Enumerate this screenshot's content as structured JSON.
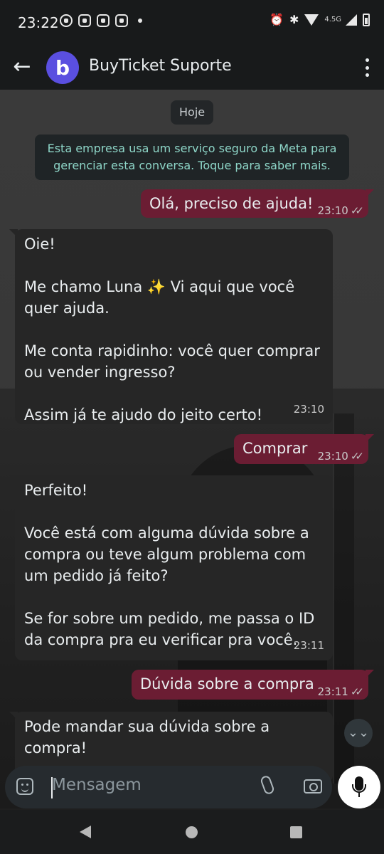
{
  "status_bar": {
    "time": "23:22",
    "network": "4.5G"
  },
  "header": {
    "title": "BuyTicket Suporte",
    "avatar_letter": "b",
    "back_icon": "arrow-left-icon",
    "menu_icon": "kebab-menu-icon"
  },
  "chat": {
    "date_chip": "Hoje",
    "encryption_notice": "Esta empresa usa um serviço seguro da Meta para gerenciar esta conversa. Toque para saber mais.",
    "messages": [
      {
        "direction": "out",
        "text": "Olá, preciso de ajuda!",
        "time": "23:10",
        "status": "delivered"
      },
      {
        "direction": "in",
        "text": "Oie!\n\nMe chamo Luna ✨ Vi aqui que você quer ajuda.\n\nMe conta rapidinho: você quer comprar ou vender ingresso?\n\nAssim já te ajudo do jeito certo!",
        "time": "23:10"
      },
      {
        "direction": "out",
        "text": "Comprar",
        "time": "23:10",
        "status": "delivered"
      },
      {
        "direction": "in",
        "text": "Perfeito!\n\nVocê está com alguma dúvida sobre a compra ou teve algum problema com um pedido já feito?\n\nSe for sobre um pedido, me passa o ID da compra pra eu verificar pra você.",
        "time": "23:11"
      },
      {
        "direction": "out",
        "text": "Dúvida sobre a compra",
        "time": "23:11",
        "status": "delivered"
      },
      {
        "direction": "in",
        "text": "Pode mandar sua dúvida sobre a compra!",
        "time": ""
      }
    ]
  },
  "composer": {
    "placeholder": "Mensagem",
    "emoji_icon": "sticker-icon",
    "attach_icon": "paperclip-icon",
    "camera_icon": "camera-icon",
    "mic_icon": "microphone-icon"
  },
  "colors": {
    "outgoing_bubble": "#6b1d33",
    "incoming_bubble": "#262626",
    "avatar": "#5a4fe0",
    "notice_text": "#8ed6c8"
  }
}
